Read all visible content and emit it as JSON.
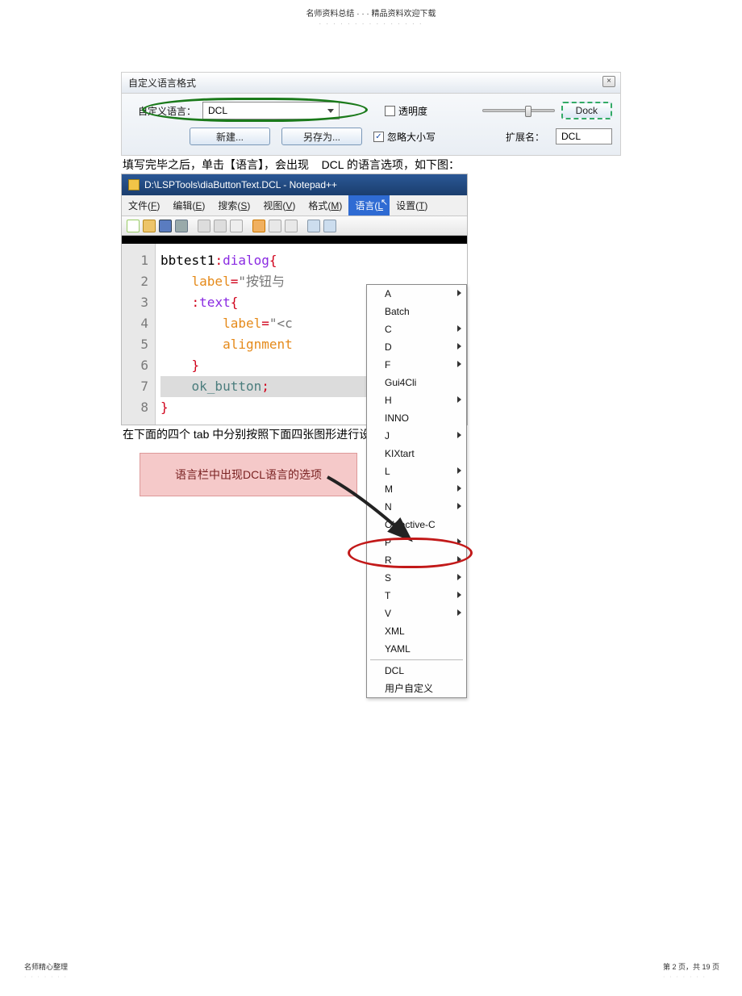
{
  "header": {
    "top": "名师资料总结 · · · 精品资料欢迎下载",
    "dots": "· · · · · · · · · · · · · · ·"
  },
  "dlg1": {
    "title": "自定义语言格式",
    "close": "×",
    "lang_label": "自定义语言：",
    "lang_value": "DCL",
    "transparent": "透明度",
    "dock": "Dock",
    "new_btn": "新建...",
    "saveas_btn": "另存为...",
    "ignorecase": "忽略大小写",
    "ext_label": "扩展名：",
    "ext_value": "DCL"
  },
  "caption1_a": "填写完毕之后，单击【语言】，会出现",
  "caption1_b": "DCL 的语言选项，如下图：",
  "npp": {
    "title": "D:\\LSPTools\\diaButtonText.DCL - Notepad++",
    "menu": {
      "file": "文件(",
      "file_u": "F",
      "file_e": ")",
      "edit": "编辑(",
      "edit_u": "E",
      "edit_e": ")",
      "search": "搜索(",
      "search_u": "S",
      "search_e": ")",
      "view": "视图(",
      "view_u": "V",
      "view_e": ")",
      "format": "格式(",
      "format_u": "M",
      "format_e": ")",
      "lang": "语言(",
      "lang_u": "L",
      "lang_e": "",
      "settings": "设置(",
      "settings_u": "T",
      "settings_e": ")"
    },
    "lines": [
      "1",
      "2",
      "3",
      "4",
      "5",
      "6",
      "7",
      "8"
    ],
    "code": {
      "l1a": "bbtest1",
      "l1b": ":",
      "l1c": "dialog",
      "l1d": "{",
      "l2a": "label",
      "l2b": "=",
      "l2c": "\"按钮与",
      "l3a": ":",
      "l3b": "text",
      "l3c": "{",
      "l4a": "label",
      "l4b": "=",
      "l4c": "\"<c",
      "l5a": "alignment",
      "l6": "}",
      "l7": "ok_button",
      "l7b": ";",
      "l8": "}"
    },
    "dropdown": {
      "items_arrow": [
        "A",
        "C",
        "D",
        "F",
        "H",
        "J",
        "L",
        "M",
        "N",
        "P",
        "R",
        "S",
        "T",
        "V"
      ],
      "items_plain": [
        "Batch",
        "Gui4Cli",
        "INNO",
        "KIXtart",
        "Objective-C",
        "XML",
        "YAML"
      ],
      "bottom1": "DCL",
      "bottom2": "用户自定义"
    },
    "note": "语言栏中出现DCL语言的选项"
  },
  "caption2_a": "在下面的四个",
  "caption2_b": "tab",
  "caption2_c": "中分别按照下面四张图形进行设置：",
  "footer": {
    "left": "名师精心整理",
    "right_a": "第 2 页，共 19 页",
    "dots": "· · · · · · ·"
  }
}
